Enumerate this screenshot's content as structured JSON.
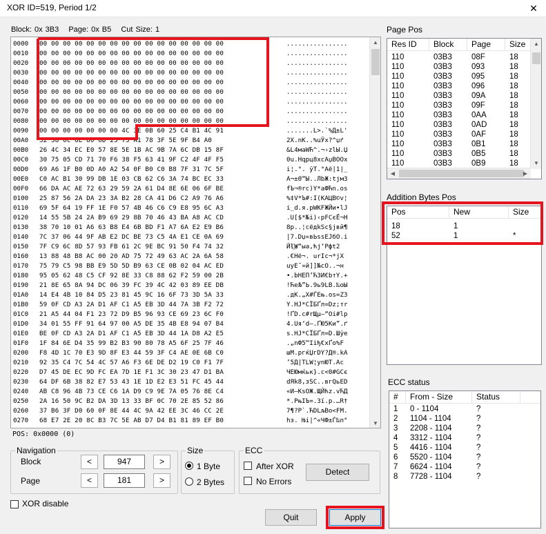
{
  "window": {
    "title": "XOR ID=519, Period 1/2",
    "close_glyph": "✕"
  },
  "block_info": {
    "block": "Block: 0x 3B3",
    "page": "Page: 0x B5",
    "cut_size": "Cut Size: 1"
  },
  "hex_rows": [
    {
      "addr": "0000",
      "bytes": "00 00 00 00 00 00 00 00 00 00 00 00 00 00 00 00",
      "ascii": "................"
    },
    {
      "addr": "0010",
      "bytes": "00 00 00 00 00 00 00 00 00 00 00 00 00 00 00 00",
      "ascii": "................"
    },
    {
      "addr": "0020",
      "bytes": "00 00 00 00 00 00 00 00 00 00 00 00 00 00 00 00",
      "ascii": "................"
    },
    {
      "addr": "0030",
      "bytes": "00 00 00 00 00 00 00 00 00 00 00 00 00 00 00 00",
      "ascii": "................"
    },
    {
      "addr": "0040",
      "bytes": "00 00 00 00 00 00 00 00 00 00 00 00 00 00 00 00",
      "ascii": "................"
    },
    {
      "addr": "0050",
      "bytes": "00 00 00 00 00 00 00 00 00 00 00 00 00 00 00 00",
      "ascii": "................"
    },
    {
      "addr": "0060",
      "bytes": "00 00 00 00 00 00 00 00 00 00 00 00 00 00 00 00",
      "ascii": "................"
    },
    {
      "addr": "0070",
      "bytes": "00 00 00 00 00 00 00 00 00 00 00 00 00 00 00 00",
      "ascii": "................"
    },
    {
      "addr": "0080",
      "bytes": "00 00 00 00 00 00 00 00 00 00 00 00 00 00 00 00",
      "ascii": "................"
    },
    {
      "addr": "0090",
      "bytes": "00 00 00 00 00 00 00 4C 3E 0B 60 25 C4 B1 4C 91",
      "ascii": ".......L>.`%Д±L'"
    },
    {
      "addr": "00A0",
      "bytes": "32 58 0C 6E 80 0D 25 75 A1 78 3F 5E 9F B4 A0 ",
      "ascii": "2X.nK..%uЎx?^џґ "
    },
    {
      "addr": "00B0",
      "bytes": "26 4C 34 EC E0 57 8E 5E 1B AC 9B 7A 6C DB 15 8F",
      "ascii": "&L4мaWЋ^.¬›zlЫ.Џ"
    },
    {
      "addr": "00C0",
      "bytes": "30 75 05 CD 71 70 F6 38 F5 63 41 9F C2 4F 4F F5",
      "ascii": "0u.Hqpц8хcAџВOOх"
    },
    {
      "addr": "00D0",
      "bytes": "69 A6 1F B0 0D A0 A2 54 0F B0 C0 B8 7F 31 7C 5F",
      "ascii": "i¦.°. ўT.°Аё|1|_"
    },
    {
      "addr": "00E0",
      "bytes": "C0 AC B1 30 99 DB 1E 03 CB 62 C6 3A 74 BC EC 33",
      "ascii": "А¬±0™Ы..ЛbЖ:tјм3"
    },
    {
      "addr": "00F0",
      "bytes": "66 DA AC AE 72 63 29 59 2A 61 D4 8E 6E 06 6F BE",
      "ascii": "fЪ¬®rc)Y*aФЋn.oѕ"
    },
    {
      "addr": "0100",
      "bytes": "25 87 56 2A DA 23 3A B2 28 CA 41 D6 C2 A9 76 A6",
      "ascii": "%‡V*Ъ#:І(КAЦВ©v¦"
    },
    {
      "addr": "0110",
      "bytes": "69 5F 64 19 FF 1E F0 57 4B 46 C6 C9 E8 95 6C A3",
      "ascii": "i_d.я.рWKFЖЙи•lЈ"
    },
    {
      "addr": "0120",
      "bytes": "14 55 5B 24 2A B9 69 29 8B 70 46 43 BA A8 AC CD",
      "ascii": ".U[$*№i)‹pFCєЁ¬Н"
    },
    {
      "addr": "0130",
      "bytes": "38 70 10 01 A6 63 B8 E4 6B BD F1 A7 6A E2 E9 B6",
      "ascii": "8p..¦cёдkЅс§jвй¶"
    },
    {
      "addr": "0140",
      "bytes": "7C 37 06 44 9F AB E2 DC BE 73 C5 4A E1 CE 0A 69",
      "ascii": "|7.Dџ«вЬѕsЕJбО.i"
    },
    {
      "addr": "0150",
      "bytes": "7F C9 6C 8D 57 93 FB 61 2C 9E BC 91 50 F4 74 32",
      "ascii": "Йl҈W“ыa,ћј‘Pфt2"
    },
    {
      "addr": "0160",
      "bytes": "13 88 48 B8 AC 00 20 AD 75 72 49 63 AC 2A 6A 58",
      "ascii": ".€Hё¬. urIc¬*jX"
    },
    {
      "addr": "0170",
      "bytes": "75 79 C5 98 BB E9 5D 5D B9 63 CE 0B 02 04 AC ED",
      "ascii": "uyЕ˜»й]]№cО..¬н"
    },
    {
      "addr": "0180",
      "bytes": "95 05 62 48 C5 CF 92 8E 33 C8 88 62 F2 59 00 2B",
      "ascii": "•.bHЕП’Ћ3И€bтY.+"
    },
    {
      "addr": "0190",
      "bytes": "21 8E 65 8A 94 DC 06 39 FC 39 4C 42 03 89 EE DB",
      "ascii": "!ЋeЉ”Ь.9ь9LB.‰оЫ"
    },
    {
      "addr": "01A0",
      "bytes": "14 E4 4B 10 84 D5 23 81 45 9C 16 6F 73 3D 5A 33",
      "ascii": ".дK.„Х#ЃEњ.os=Z3"
    },
    {
      "addr": "01B0",
      "bytes": "59 0F CD A3 2A D1 AF C1 A5 EB 3D 44 7A 3B F2 72",
      "ascii": "Y.НЈ*СЇБҐл=Dz;тr"
    },
    {
      "addr": "01C0",
      "bytes": "21 A5 44 04 F1 23 72 D9 B5 96 93 CE 69 23 6C F0",
      "ascii": "!ҐD.с#rЩµ–“Оi#lр"
    },
    {
      "addr": "01D0",
      "bytes": "34 01 55 FF 91 64 97 00 A5 DE 35 4B E8 94 07 B4",
      "ascii": "4.Uя‘d—.ҐЮ5Kи”.ґ"
    },
    {
      "addr": "01E0",
      "bytes": "BE 0F CD A3 2A D1 AF C1 A5 EB 3D 44 1A D8 A2 E5",
      "ascii": "ѕ.НЈ*СЇБҐл=D.Шўе"
    },
    {
      "addr": "01F0",
      "bytes": "1F 84 6E D4 35 99 B2 B3 90 80 78 A5 6F 25 7F 46",
      "ascii": ".„nФ5™Ііђ€xҐo%F"
    },
    {
      "addr": "0200",
      "bytes": "F8 4D 1C 70 E3 9D 8F E3 44 59 3F C4 AE 0E 6B C0",
      "ascii": "шM.pгќЏгDY?Д®.kА"
    },
    {
      "addr": "0210",
      "bytes": "92 35 C4 7C 54 4C 57 A6 F3 6E DE D2 19 C0 F1 7F",
      "ascii": "’5Д|TLW¦уnЮТ.Ас"
    },
    {
      "addr": "0220",
      "bytes": "D7 45 DE EC 9D FC EA 7D 1E F1 3C 30 23 47 D1 BA",
      "ascii": "ЧEЮмќьк}.с<0#GСє"
    },
    {
      "addr": "0230",
      "bytes": "64 DF 6B 38 82 E7 53 43 1E 1D E2 E3 51 FC 45 44",
      "ascii": "dЯk8‚зSC..вгQьED"
    },
    {
      "addr": "0240",
      "bytes": "AB C8 96 4B 73 CE C6 1A D9 C9 9E 7A 05 76 8E C4",
      "ascii": "«И–KsОЖ.ЩЙћz.vЋД"
    },
    {
      "addr": "0250",
      "bytes": "2A 16 50 9C B2 DA 3D 13 33 BF 0C 70 2E 85 52 86",
      "ascii": "*.PњІЪ=.3ї.p.…R†"
    },
    {
      "addr": "0260",
      "bytes": "37 B6 3F D0 60 0F 8E 44 4C 9A 42 EE 3C 46 CC 2E",
      "ascii": "7¶?Р`.ЋDLљBо<FМ."
    },
    {
      "addr": "0270",
      "bytes": "68 E7 2E 20 8C B3 7C 5E AB D7 D4 B1 81 89 EF B0",
      "ascii": "hз. Њі|^«ЧФ±Ѓ‰п°"
    }
  ],
  "pos": "POS: 0x0000  (0)",
  "navigation": {
    "legend": "Navigation",
    "block_label": "Block",
    "block_value": "947",
    "page_label": "Page",
    "page_value": "181",
    "prev_glyph": "<",
    "next_glyph": ">"
  },
  "size": {
    "legend": "Size",
    "opt1": "1 Byte",
    "opt2": "2 Bytes",
    "selected": "1 Byte"
  },
  "ecc": {
    "legend": "ECC",
    "after_xor": "After XOR",
    "no_errors": "No Errors",
    "detect": "Detect"
  },
  "xor_disable": "XOR disable",
  "buttons": {
    "quit": "Quit",
    "apply": "Apply"
  },
  "page_pos": {
    "label": "Page Pos",
    "columns": [
      "Res ID",
      "Block",
      "Page",
      "Size"
    ],
    "rows": [
      [
        "110",
        "03B3",
        "08F",
        "18"
      ],
      [
        "110",
        "03B3",
        "093",
        "18"
      ],
      [
        "110",
        "03B3",
        "095",
        "18"
      ],
      [
        "110",
        "03B3",
        "096",
        "18"
      ],
      [
        "110",
        "03B3",
        "09A",
        "18"
      ],
      [
        "110",
        "03B3",
        "09F",
        "18"
      ],
      [
        "110",
        "03B3",
        "0AA",
        "18"
      ],
      [
        "110",
        "03B3",
        "0AD",
        "18"
      ],
      [
        "110",
        "03B3",
        "0AF",
        "18"
      ],
      [
        "110",
        "03B3",
        "0B1",
        "18"
      ],
      [
        "110",
        "03B3",
        "0B5",
        "18"
      ],
      [
        "110",
        "03B3",
        "0B9",
        "18"
      ]
    ]
  },
  "addition_bytes": {
    "label": "Addition Bytes Pos",
    "columns": [
      "Pos",
      "New",
      "Size"
    ],
    "rows": [
      [
        "18",
        "1",
        ""
      ],
      [
        "52",
        "1",
        "*"
      ]
    ]
  },
  "ecc_status": {
    "label": "ECC status",
    "columns": [
      "#",
      "From - Size",
      "Status"
    ],
    "rows": [
      [
        "1",
        "0 - 1104",
        "?"
      ],
      [
        "2",
        "1104 - 1104",
        "?"
      ],
      [
        "3",
        "2208 - 1104",
        "?"
      ],
      [
        "4",
        "3312 - 1104",
        "?"
      ],
      [
        "5",
        "4416 - 1104",
        "?"
      ],
      [
        "6",
        "5520 - 1104",
        "?"
      ],
      [
        "7",
        "6624 - 1104",
        "?"
      ],
      [
        "8",
        "7728 - 1104",
        "?"
      ]
    ]
  },
  "colors": {
    "highlight": "#e6141e",
    "accent": "#0078d7"
  }
}
